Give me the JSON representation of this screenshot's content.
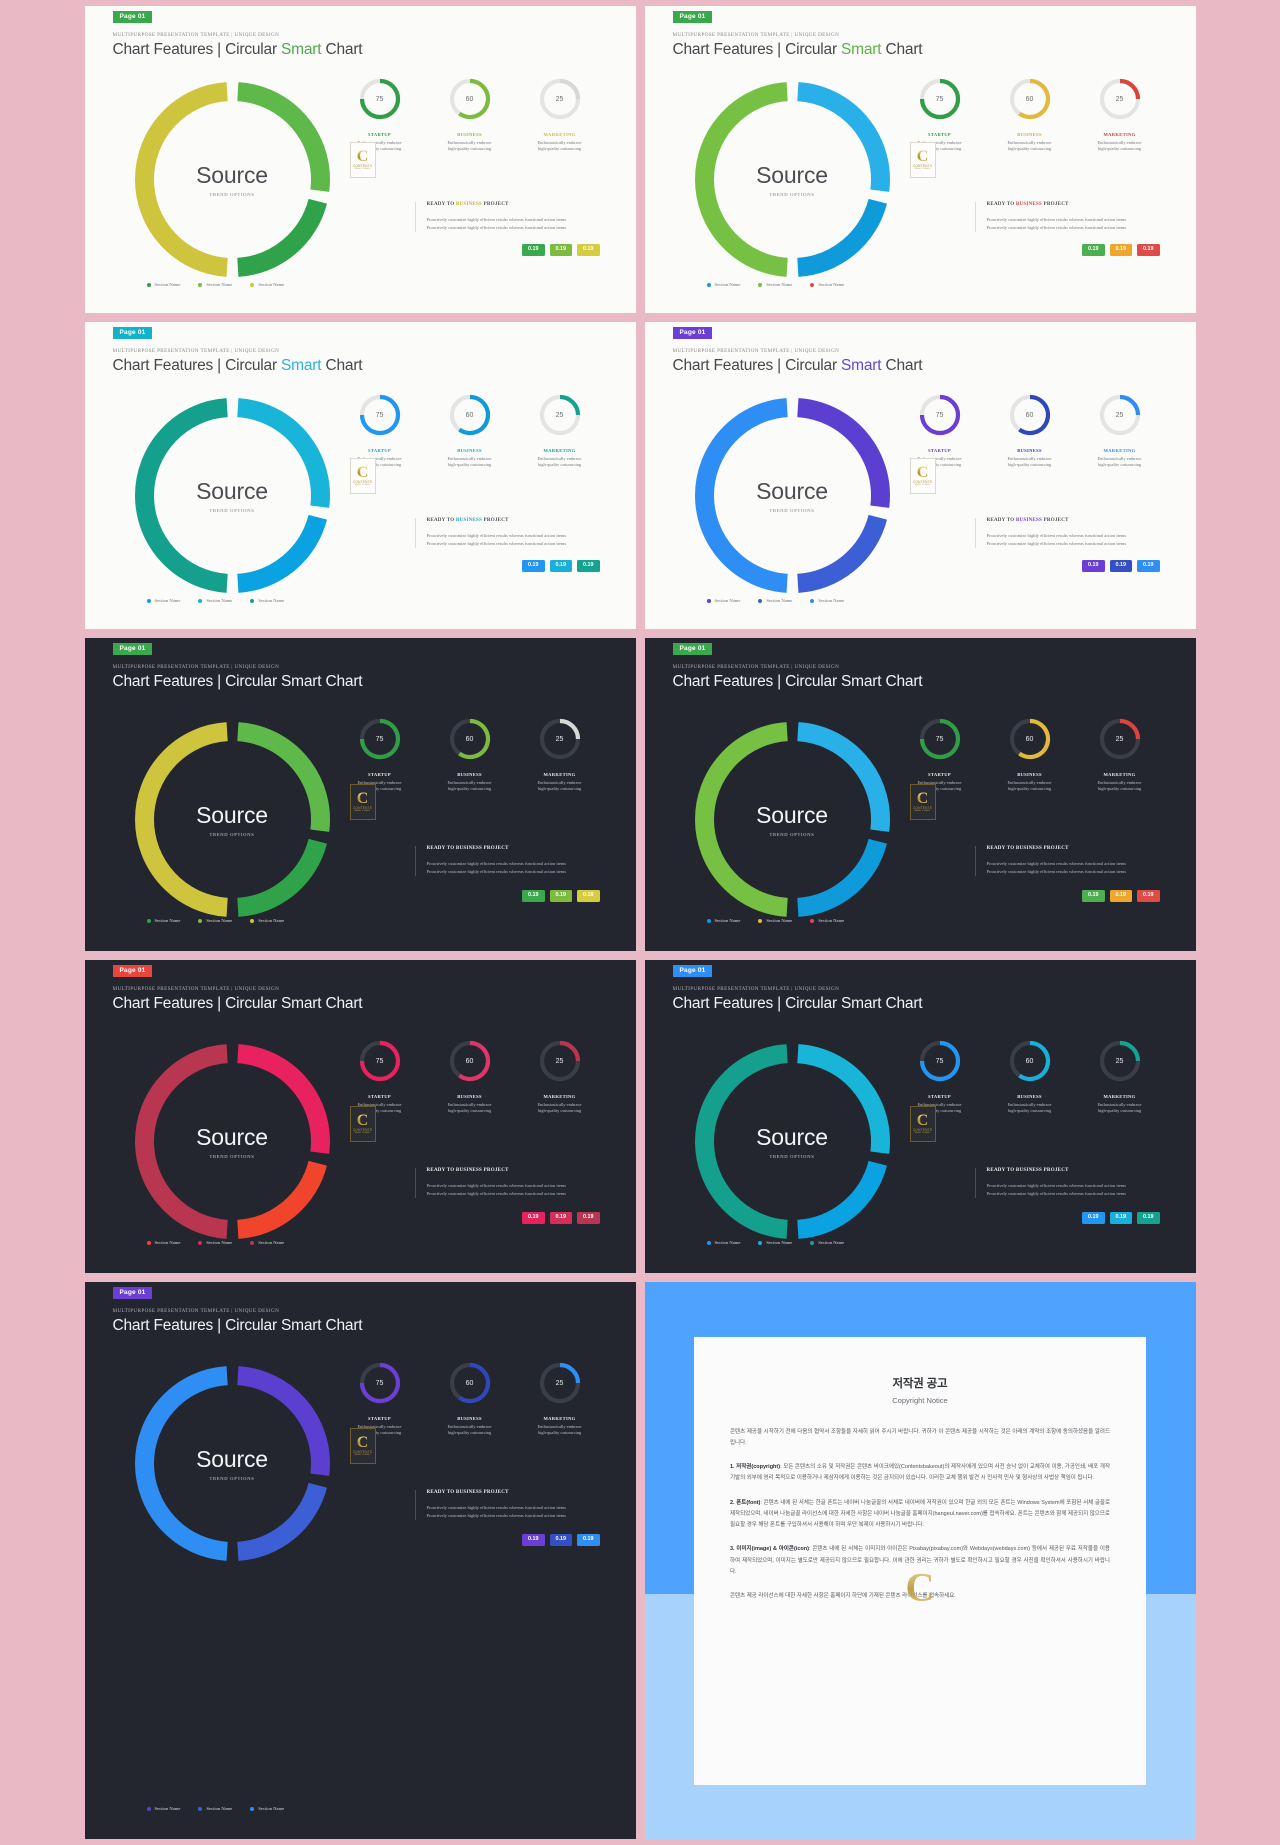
{
  "common": {
    "page_badge": "Page 01",
    "kicker": "MULTIPURPOSE PRESENTATION TEMPLATE | UNIQUE DESIGN",
    "title_main": "Chart Features  |  Circular ",
    "title_accent": "Smart",
    "title_tail": " Chart",
    "center_label": "Source",
    "center_sub": "TREND OPTIONS",
    "ready_heading_a": "READY TO ",
    "ready_heading_b": "BUSINESS",
    "ready_heading_c": " PROJECT",
    "ready_line1": "Proactively customize highly efficient results whereas functional action items",
    "ready_line2": "Proactively customize highly efficient results whereas functional action items",
    "legend_label": "Section Name",
    "chip_value": "0.19",
    "logo_letter": "C",
    "logo_word1": "CONTENTS",
    "logo_word2": "REAL CLASS",
    "kpis": [
      {
        "value": "75",
        "name": "STARTUP",
        "desc_l1": "Enthusiastically embrace",
        "desc_l2": "high-quality outsourcing"
      },
      {
        "value": "60",
        "name": "BUSINESS",
        "desc_l1": "Enthusiastically embrace",
        "desc_l2": "high-quality outsourcing"
      },
      {
        "value": "25",
        "name": "MARKETING",
        "desc_l1": "Enthusiastically embrace",
        "desc_l2": "high-quality outsourcing"
      }
    ]
  },
  "chart_data": {
    "type": "pie",
    "title": "Circular Smart Chart",
    "categories": [
      "Section Name",
      "Section Name",
      "Section Name"
    ],
    "values": [
      28,
      22,
      50
    ],
    "gauge_series": [
      {
        "label": "STARTUP",
        "value": 75,
        "max": 100
      },
      {
        "label": "BUSINESS",
        "value": 60,
        "max": 100
      },
      {
        "label": "MARKETING",
        "value": 25,
        "max": 100
      }
    ],
    "chips": [
      0.19,
      0.19,
      0.19
    ],
    "legend_position": "bottom-left",
    "grid": false
  },
  "slides": [
    {
      "id": "s1",
      "theme": "light",
      "badge_color": "#3aa94b",
      "title_accent_color": "#4fa84f",
      "donut": [
        "#5fb84a",
        "#2fa24a",
        "#cfc43e"
      ],
      "gauges": [
        "#2f9e45",
        "#7dbb3f",
        "#d8d8d8"
      ],
      "gauge_name_colors": [
        "#3a9b47",
        "#8bbd3e",
        "#d2b93c"
      ],
      "chips": [
        "#3aa94b",
        "#7dbb3f",
        "#d5cc3f"
      ],
      "legend_dots": [
        "#2fa24a",
        "#7dbb3f",
        "#cfc43e"
      ],
      "ready_accent": "#cfae2e"
    },
    {
      "id": "s2",
      "theme": "light",
      "badge_color": "#3aa94b",
      "title_accent_color": "#5bb347",
      "donut": [
        "#2ab0e8",
        "#0f9ad9",
        "#76c043"
      ],
      "gauges": [
        "#2f9e45",
        "#e2b93c",
        "#d9453c"
      ],
      "gauge_name_colors": [
        "#3a9b47",
        "#d9a93a",
        "#cf4038"
      ],
      "chips": [
        "#4caf50",
        "#f0a62c",
        "#e14b45"
      ],
      "legend_dots": [
        "#0f9ad9",
        "#76c043",
        "#e14b45"
      ],
      "ready_accent": "#d9453c"
    },
    {
      "id": "s3",
      "theme": "light",
      "badge_color": "#12b3c7",
      "title_accent_color": "#2ab3e0",
      "donut": [
        "#19b5d8",
        "#0aa2e0",
        "#14a08c"
      ],
      "gauges": [
        "#2196f3",
        "#0f9ad9",
        "#13a38d"
      ],
      "gauge_name_colors": [
        "#2a9fd6",
        "#1aa8c4",
        "#17a18d"
      ],
      "chips": [
        "#2196f3",
        "#18b0d8",
        "#14a38f"
      ],
      "legend_dots": [
        "#2196f3",
        "#18b0d8",
        "#14a38f"
      ],
      "ready_accent": "#1aa8c4"
    },
    {
      "id": "s4",
      "theme": "light",
      "badge_color": "#6b3fd4",
      "title_accent_color": "#6a45d6",
      "donut": [
        "#5b3fd1",
        "#3c5fd6",
        "#2f8ef4"
      ],
      "gauges": [
        "#6b3fd4",
        "#2f47b8",
        "#2f8ef4"
      ],
      "gauge_name_colors": [
        "#6b3fd4",
        "#2f47b8",
        "#2f8ef4"
      ],
      "chips": [
        "#6b3fd4",
        "#3550c4",
        "#2f8ef4"
      ],
      "legend_dots": [
        "#5b3fd1",
        "#3c5fd6",
        "#2f8ef4"
      ],
      "ready_accent": "#6b3fd4"
    },
    {
      "id": "s5",
      "theme": "dark",
      "badge_color": "#3aa94b",
      "title_accent_color": "#f2f3f5",
      "donut": [
        "#5fb84a",
        "#2fa24a",
        "#cfc43e"
      ],
      "gauges": [
        "#2f9e45",
        "#7dbb3f",
        "#d8d8d8"
      ],
      "gauge_name_colors": [
        "#e6e8ec",
        "#e6e8ec",
        "#e6e8ec"
      ],
      "chips": [
        "#3aa94b",
        "#7dbb3f",
        "#d5cc3f"
      ],
      "legend_dots": [
        "#2fa24a",
        "#7dbb3f",
        "#cfc43e"
      ],
      "ready_accent": "#eceef1"
    },
    {
      "id": "s6",
      "theme": "dark",
      "badge_color": "#3aa94b",
      "title_accent_color": "#f2f3f5",
      "donut": [
        "#2ab0e8",
        "#0f9ad9",
        "#76c043"
      ],
      "gauges": [
        "#2f9e45",
        "#e2b93c",
        "#d9453c"
      ],
      "gauge_name_colors": [
        "#e6e8ec",
        "#e6e8ec",
        "#e6e8ec"
      ],
      "chips": [
        "#4caf50",
        "#f0a62c",
        "#e14b45"
      ],
      "legend_dots": [
        "#0f9ad9",
        "#e2b93c",
        "#e14b45"
      ],
      "ready_accent": "#eceef1"
    },
    {
      "id": "s7",
      "theme": "dark",
      "badge_color": "#e8453c",
      "title_accent_color": "#f2f3f5",
      "donut": [
        "#e8225e",
        "#f0452c",
        "#b8364f"
      ],
      "gauges": [
        "#e8225e",
        "#e0356b",
        "#b8364f"
      ],
      "gauge_name_colors": [
        "#e6e8ec",
        "#e6e8ec",
        "#e6e8ec"
      ],
      "chips": [
        "#e8225e",
        "#d42f58",
        "#b8364f"
      ],
      "legend_dots": [
        "#f0452c",
        "#e8225e",
        "#b8364f"
      ],
      "ready_accent": "#eceef1"
    },
    {
      "id": "s8",
      "theme": "dark",
      "badge_color": "#2f8ef4",
      "title_accent_color": "#f2f3f5",
      "donut": [
        "#19b5d8",
        "#0aa2e0",
        "#14a08c"
      ],
      "gauges": [
        "#2196f3",
        "#18b0d8",
        "#14a38f"
      ],
      "gauge_name_colors": [
        "#e6e8ec",
        "#e6e8ec",
        "#e6e8ec"
      ],
      "chips": [
        "#2196f3",
        "#18b0d8",
        "#14a38f"
      ],
      "legend_dots": [
        "#2196f3",
        "#18b0d8",
        "#14a38f"
      ],
      "ready_accent": "#eceef1"
    },
    {
      "id": "s9",
      "theme": "dark",
      "badge_color": "#6b3fd4",
      "title_accent_color": "#f2f3f5",
      "donut": [
        "#5b3fd1",
        "#3c5fd6",
        "#2f8ef4"
      ],
      "gauges": [
        "#6b3fd4",
        "#2f47b8",
        "#2f8ef4"
      ],
      "gauge_name_colors": [
        "#e6e8ec",
        "#e6e8ec",
        "#e6e8ec"
      ],
      "chips": [
        "#6b3fd4",
        "#3550c4",
        "#2f8ef4"
      ],
      "legend_dots": [
        "#5b3fd1",
        "#3c5fd6",
        "#2f8ef4"
      ],
      "ready_accent": "#eceef1"
    }
  ],
  "copyright": {
    "title_ko": "저작권 공고",
    "title_en": "Copyright Notice",
    "intro": "콘텐츠 제공을 시작하기 전에 다음의 협약서 조항들을 자세히 읽어 주시기 바랍니다. 귀하가 이 콘텐츠 제공을 시작하는 것은 아래의 계약의 조항에 동의하셨음을 알려드립니다.",
    "p1_label": "1. 저작권(copyright)",
    "p1": ": 모든 콘텐츠의 소유 및 저작권은 콘텐츠 바이크에있(Contentsbakeout)의 제작사에게 있으며 사전 승낙 없이 교체하여 이용, 가공인쇄, 배포 개작 기발의 외부에 영리 목적으로 이용하거나 제삼자에게 이용하는 것은 금지되어 있습니다. 이러한 교체 행위 발견 시 민사적 민사 및 형사상의 사법상 책임이 됩니다.",
    "p2_label": "2. 폰트(font)",
    "p2": ": 콘텐츠 내에 된 서체는 한글 폰트는 네이버 나눔글꼴의 서체로 네이버에 저작권이 있으며 한글 외의 모든 폰트는 Windows System에 포함된 서체 글꼴로 제작되었으며, 네이버 나눔글꼴 라이선스에 대한 자세한 사항은 네이버 나눔글꼴 홈페이지(hangeul.naver.com)를 접속하세요. 폰트는 콘텐츠와 함께 제공되지 않으므로 필요할 경우 해당 폰트를 구입하셔서 사용해야 하며 무단 복제이 사용하시기 바랍니다.",
    "p3_label": "3. 이미지(image) & 아이콘(icon)",
    "p3": ": 콘텐츠 내에 된 서체는 이미지와 아이콘은 Pixabay(pixabay.com)와 Webdays(webdays.com) 등에서 제공된 무료 저작물을 이용하여 제작되었으며, 이미지는 별도로만 제공되지 않으므로 필요합니다. 이에 관한 권리는 귀하가 별도로 확인하시고 필요할 경우 사진을 확인하셔서 사용하시기 바랍니다.",
    "outro": "콘텐츠 제공 라이선스에 대한 자세한 사항은 홈페이지 하단에 기재된 콘텐츠 라이선스를 접속하세요.",
    "watermark": "C"
  }
}
